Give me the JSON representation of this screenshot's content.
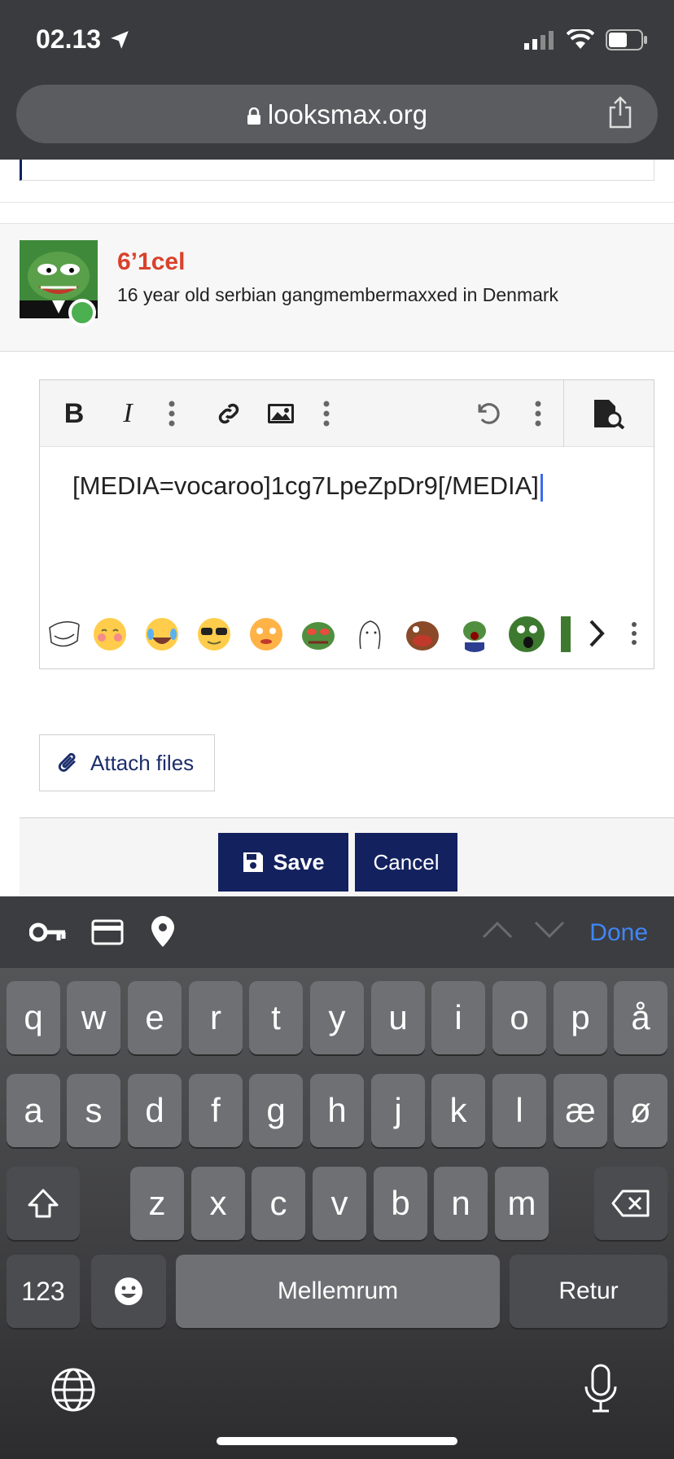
{
  "status_bar": {
    "time": "02.13",
    "icons": [
      "location-arrow-icon",
      "signal-icon",
      "wifi-icon",
      "battery-icon"
    ]
  },
  "browser": {
    "url": "looksmax.org",
    "icons": [
      "lock-icon",
      "share-icon"
    ]
  },
  "author": {
    "username": "6’1cel",
    "user_title": "16 year old serbian gangmembermaxxed in Denmark",
    "colors": {
      "username": "#d9412b"
    }
  },
  "editor": {
    "toolbar": [
      "bold-icon",
      "italic-icon",
      "more-vertical-icon",
      "link-icon",
      "image-icon",
      "more-vertical-icon",
      "undo-icon",
      "more-vertical-icon",
      "preview-icon"
    ],
    "content": "[MEDIA=vocaroo]1cg7LpeZpDr9[/MEDIA]",
    "emoji_icons": [
      "troll-face-icon",
      "blush-emoji-icon",
      "crying-laughing-emoji-icon",
      "sunglasses-emoji-icon",
      "flushed-emoji-icon",
      "angry-pepe-icon",
      "wojak-icon",
      "pepe-rage-icon",
      "pepe-suit-icon",
      "pepe-shocked-icon",
      "pepe-partial-icon"
    ]
  },
  "attach": {
    "label": "Attach files"
  },
  "actions": {
    "save": "Save",
    "cancel": "Cancel",
    "colors": {
      "button_bg": "#13215f"
    }
  },
  "accessory_bar": {
    "done": "Done",
    "icons": [
      "key-icon",
      "credit-card-icon",
      "location-pin-icon",
      "chevron-up-icon",
      "chevron-down-icon"
    ],
    "colors": {
      "done": "#3f86f7"
    }
  },
  "keyboard": {
    "row1": [
      "q",
      "w",
      "e",
      "r",
      "t",
      "y",
      "u",
      "i",
      "o",
      "p",
      "å"
    ],
    "row2": [
      "a",
      "s",
      "d",
      "f",
      "g",
      "h",
      "j",
      "k",
      "l",
      "æ",
      "ø"
    ],
    "row3": [
      "z",
      "x",
      "c",
      "v",
      "b",
      "n",
      "m"
    ],
    "numbers": "123",
    "space": "Mellemrum",
    "return": "Retur",
    "icons": [
      "shift-icon",
      "backspace-icon",
      "emoji-icon",
      "globe-icon",
      "microphone-icon"
    ]
  }
}
